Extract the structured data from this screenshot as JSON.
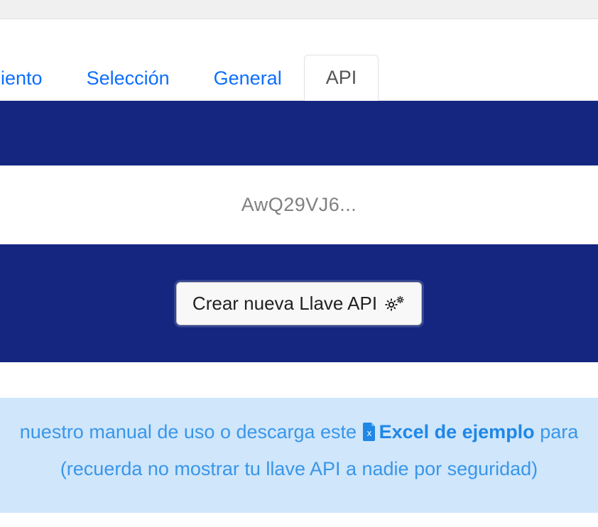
{
  "tabs": {
    "partial_first": "iento",
    "seleccion": "Selección",
    "general": "General",
    "api": "API"
  },
  "api_key_masked": "AwQ29VJ6...",
  "create_button_label": "Crear nueva Llave API",
  "info": {
    "line1_prefix": "nuestro manual de uso o descarga este ",
    "excel_link_label": "Excel de ejemplo",
    "line1_suffix": " para",
    "line2": "(recuerda no mostrar tu llave API a nadie por seguridad)"
  },
  "colors": {
    "link_blue": "#0d6efd",
    "deep_blue": "#14267f",
    "info_bg": "#cfe6fb",
    "info_text": "#3a96e8"
  }
}
